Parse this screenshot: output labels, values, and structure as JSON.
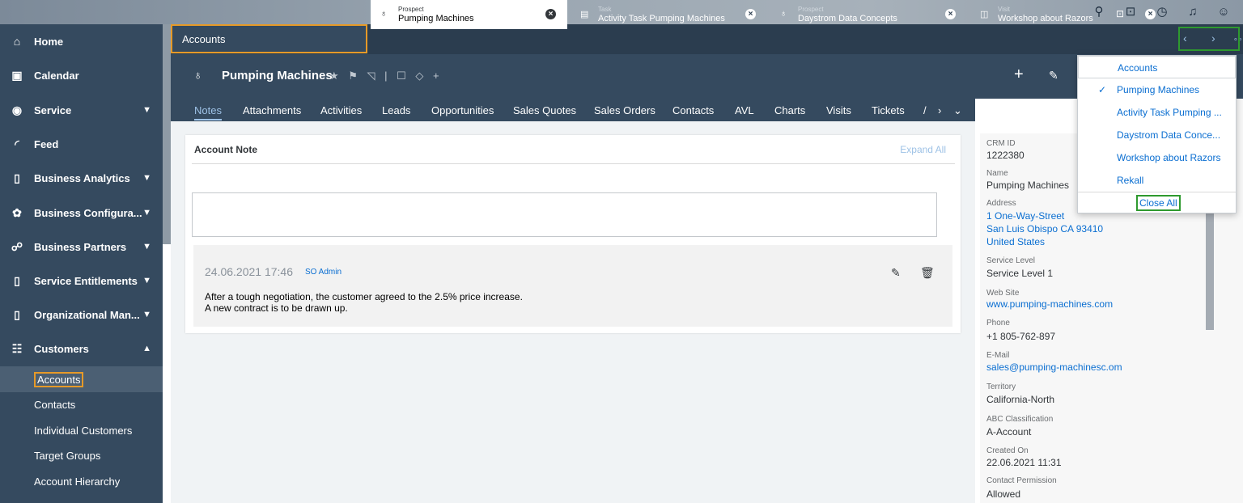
{
  "shell": {
    "icons": [
      "search-icon",
      "feedback-icon",
      "history-icon",
      "bell-icon",
      "user-icon"
    ]
  },
  "sidebar": {
    "items": [
      {
        "label": "Home",
        "icon": "home-icon"
      },
      {
        "label": "Calendar",
        "icon": "calendar-icon"
      },
      {
        "label": "Service",
        "icon": "service-icon"
      },
      {
        "label": "Feed",
        "icon": "feed-icon"
      },
      {
        "label": "Business Analytics",
        "icon": "analytics-icon"
      },
      {
        "label": "Business Configura...",
        "icon": "configuration-icon"
      },
      {
        "label": "Business Partners",
        "icon": "partners-icon"
      },
      {
        "label": "Service Entitlements",
        "icon": "entitlements-icon"
      },
      {
        "label": "Organizational Man...",
        "icon": "organization-icon"
      },
      {
        "label": "Customers",
        "icon": "customers-icon"
      }
    ],
    "subitems": [
      "Accounts",
      "Contacts",
      "Individual Customers",
      "Target Groups",
      "Account Hierarchy"
    ]
  },
  "tabs": {
    "accounts": "Accounts",
    "items": [
      {
        "category": "Prospect",
        "title": "Pumping Machines"
      },
      {
        "category": "Task",
        "title": "Activity Task Pumping Machines"
      },
      {
        "category": "Prospect",
        "title": "Daystrom Data Concepts"
      },
      {
        "category": "Visit",
        "title": "Workshop about Razors"
      }
    ]
  },
  "object": {
    "title": "Pumping Machines",
    "actions": "★ ⚑ ◹ | ☐ ◇ +"
  },
  "section_tabs": [
    "Notes",
    "Attachments",
    "Activities",
    "Leads",
    "Opportunities",
    "Sales Quotes",
    "Sales Orders",
    "Contacts",
    "AVL",
    "Charts",
    "Visits",
    "Tickets",
    "/"
  ],
  "note": {
    "title": "Account Note",
    "expand_all": "Expand All",
    "date": "24.06.2021 17:46",
    "author": "SO Admin",
    "text1": "After a tough negotiation, the customer agreed to the 2.5% price increase.",
    "text2": "A new contract is to be drawn up."
  },
  "details": {
    "crm_id_label": "CRM ID",
    "crm_id": "1222380",
    "name_label": "Name",
    "name": "Pumping Machines",
    "address_label": "Address",
    "address1": "1 One-Way-Street",
    "address2": "San Luis Obispo CA 93410",
    "address3": "United States",
    "service_level_label": "Service Level",
    "service_level": "Service Level 1",
    "website_label": "Web Site",
    "website": "www.pumping-machines.com",
    "phone_label": "Phone",
    "phone": "+1 805-762-897",
    "email_label": "E-Mail",
    "email": "sales@pumping-machinesc.om",
    "territory_label": "Territory",
    "territory": "California-North",
    "abc_label": "ABC Classification",
    "abc": "A-Account",
    "created_label": "Created On",
    "created": "22.06.2021 11:31",
    "permission_label": "Contact Permission",
    "permission": "Allowed"
  },
  "menu": {
    "items": [
      "Accounts",
      "Pumping Machines",
      "Activity Task Pumping ...",
      "Daystrom Data Conce...",
      "Workshop about Razors",
      "Rekall"
    ],
    "close_all": "Close All"
  },
  "colors": {
    "shell": "#354a5f",
    "accent": "#e69a28",
    "link": "#0a6ed1",
    "highlight": "#2f9a2f"
  }
}
